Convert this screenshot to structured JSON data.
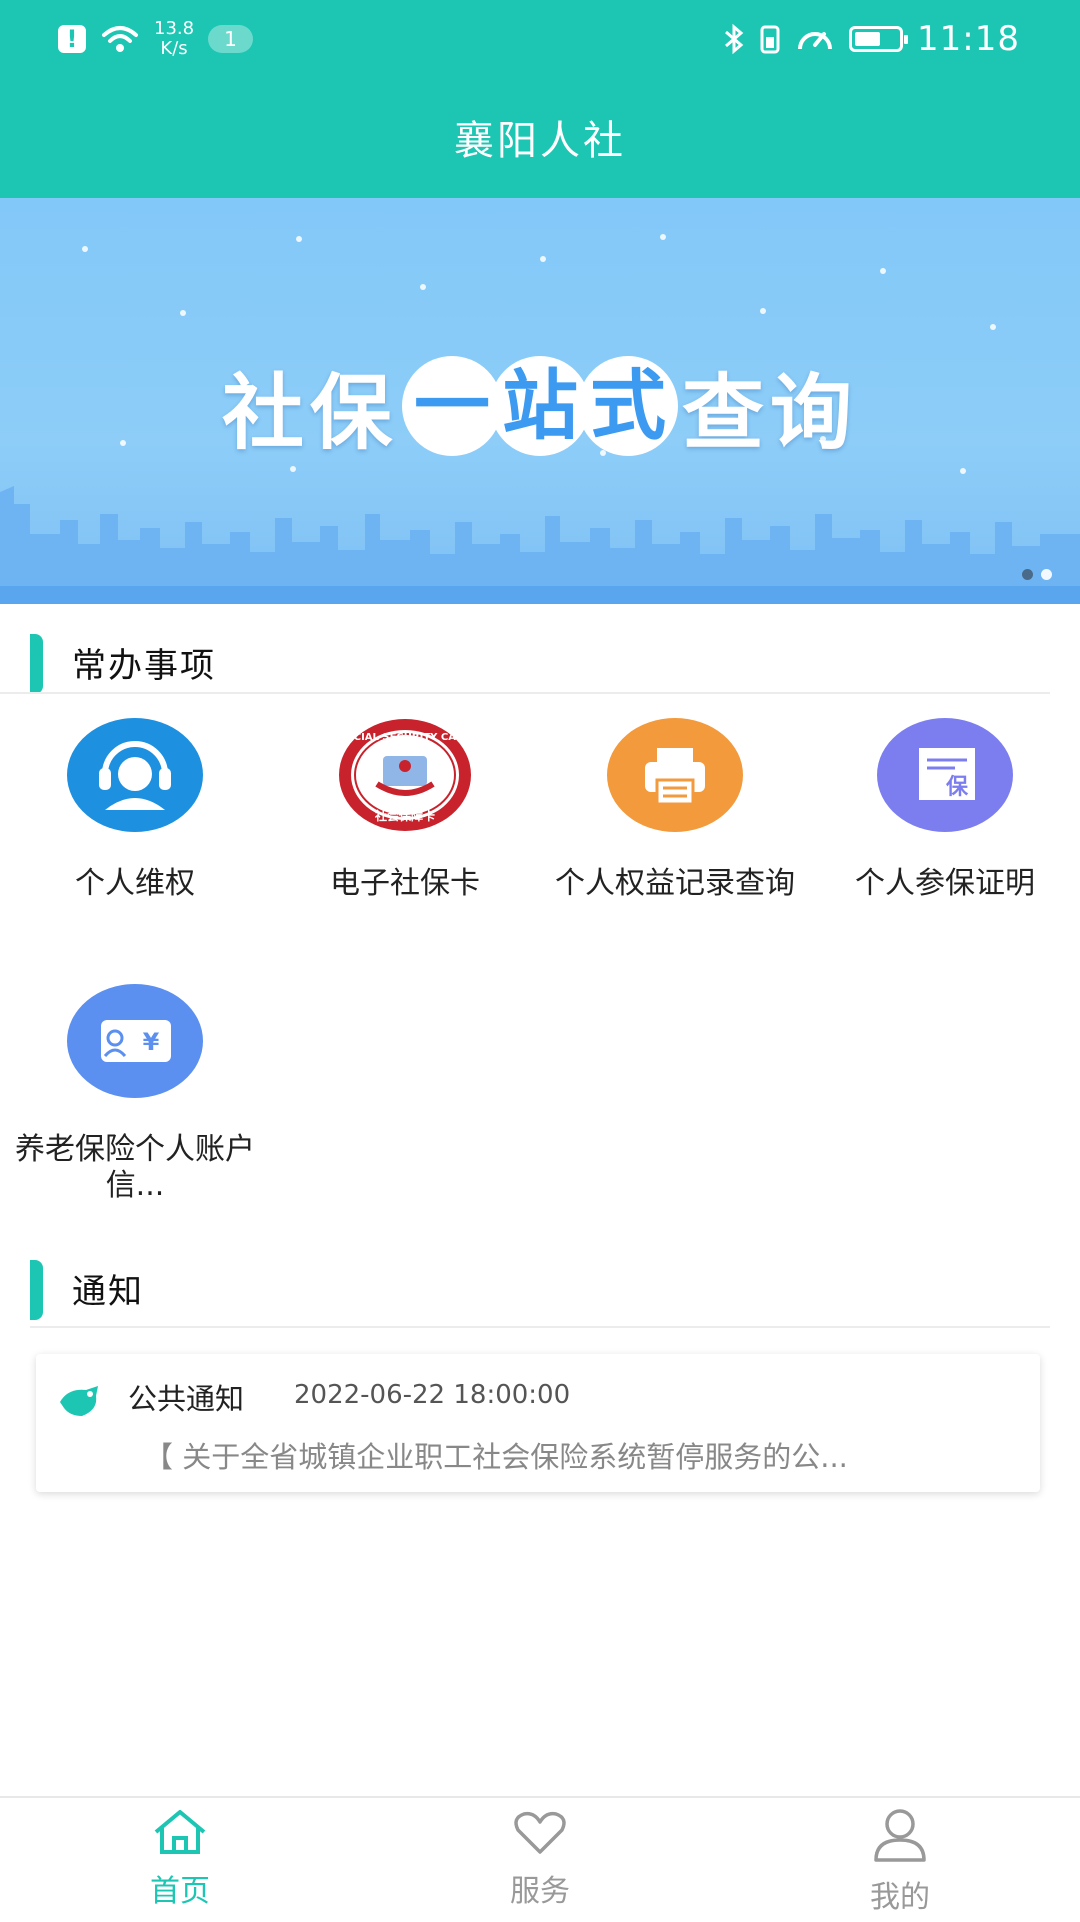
{
  "status_bar": {
    "net_speed_value": "13.8",
    "net_speed_unit": "K/s",
    "notification_count": "1",
    "time": "11:18",
    "battery_level": 0.6
  },
  "header": {
    "title": "襄阳人社"
  },
  "banner": {
    "text_left": "社保",
    "text_bubbles": [
      "一",
      "站",
      "式"
    ],
    "text_right": "查询",
    "page_count": 2,
    "active_page": 1
  },
  "sections": {
    "common": "常办事项",
    "notice": "通知"
  },
  "services": [
    {
      "label": "个人维权",
      "icon": "headset-user-icon",
      "color": "#1e90e0"
    },
    {
      "label": "电子社保卡",
      "icon": "social-security-card-icon",
      "color": "#c8232c",
      "icon_text_top": "SOCIAL SECURITY CARD",
      "icon_text_bottom": "社会保障卡"
    },
    {
      "label": "个人权益记录查询",
      "icon": "printer-icon",
      "color": "#f29a3c"
    },
    {
      "label": "个人参保证明",
      "icon": "insurance-certificate-icon",
      "color": "#7c7ef0",
      "icon_text": "保"
    },
    {
      "label": "养老保险个人账户信...",
      "icon": "pension-account-icon",
      "color": "#5b8ff0",
      "icon_text": "¥"
    }
  ],
  "notice": {
    "icon": "megaphone-icon",
    "type": "公共通知",
    "date": "2022-06-22 18:00:00",
    "text": "【 关于全省城镇企业职工社会保险系统暂停服务的公..."
  },
  "bottom_nav": [
    {
      "label": "首页",
      "icon": "home-icon",
      "active": true
    },
    {
      "label": "服务",
      "icon": "heart-icon",
      "active": false
    },
    {
      "label": "我的",
      "icon": "user-icon",
      "active": false
    }
  ],
  "colors": {
    "primary": "#1cc6b3",
    "banner": "#8dcdf8"
  }
}
